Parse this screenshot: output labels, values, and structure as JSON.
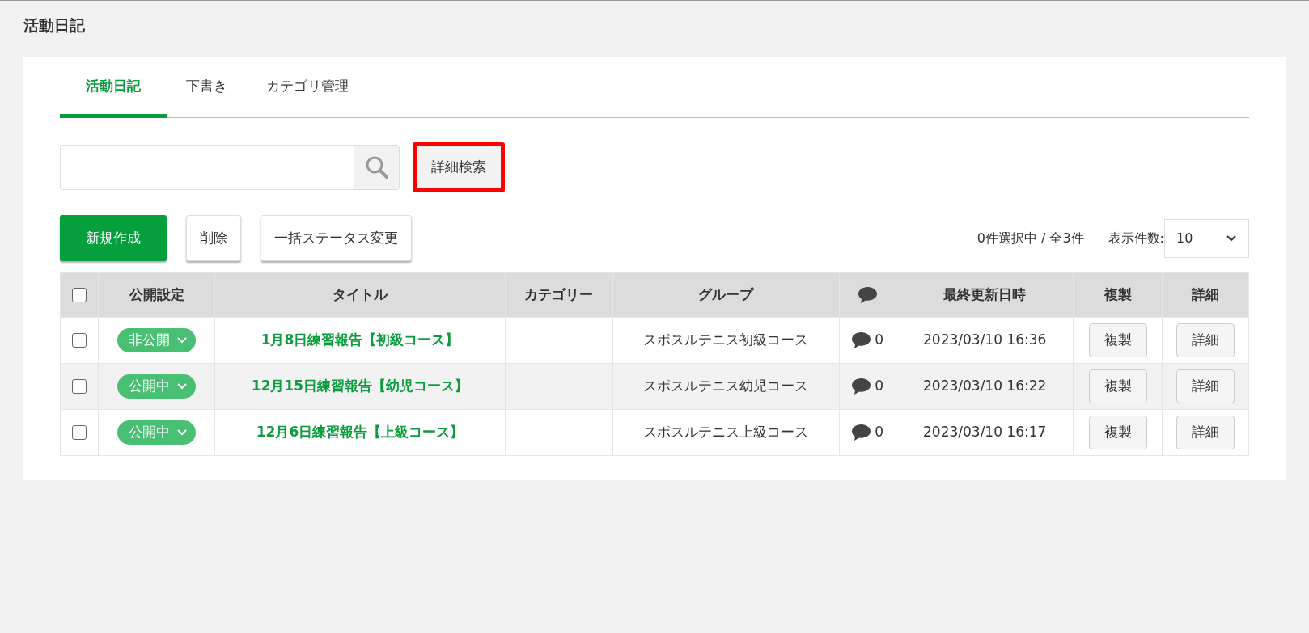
{
  "page_title": "活動日記",
  "tabs": [
    {
      "label": "活動日記",
      "selected": true
    },
    {
      "label": "下書き",
      "selected": false
    },
    {
      "label": "カテゴリ管理",
      "selected": false
    }
  ],
  "search": {
    "advanced_button": {
      "label": "詳細検索",
      "highlighted": true
    }
  },
  "actions": [
    {
      "label": "新規作成",
      "kind": "primary"
    },
    {
      "label": "削除",
      "kind": "default"
    },
    {
      "label": "一括ステータス変更",
      "kind": "default"
    }
  ],
  "selection_count": "0件選択中 / 全3件",
  "page_size": {
    "label": "表示件数:",
    "value": "10"
  },
  "table": {
    "columns": [
      "公開設定",
      "タイトル",
      "カテゴリー",
      "グループ",
      "最終更新日時",
      "複製",
      "詳細"
    ],
    "header_checked": false,
    "rows": [
      {
        "checked": false,
        "status": "非公開",
        "title": "1月8日練習報告【初級コース】",
        "group": "スポスルテニス初級コース",
        "comments": "0",
        "updated": "2023/03/10 16:36",
        "copy": "複製",
        "detail": "詳細"
      },
      {
        "checked": false,
        "status": "公開中",
        "title": "12月15日練習報告【幼児コース】",
        "group": "スポスルテニス幼児コース",
        "comments": "0",
        "updated": "2023/03/10 16:22",
        "copy": "複製",
        "detail": "詳細"
      },
      {
        "checked": false,
        "status": "公開中",
        "title": "12月6日練習報告【上級コース】",
        "group": "スポスルテニス上級コース",
        "comments": "0",
        "updated": "2023/03/10 16:17",
        "copy": "複製",
        "detail": "詳細"
      }
    ]
  }
}
